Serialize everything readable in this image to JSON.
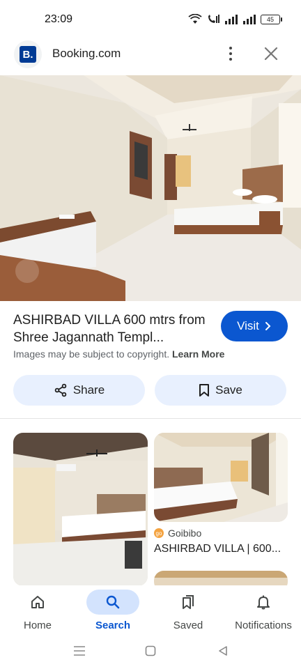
{
  "status": {
    "time": "23:09",
    "battery": "45"
  },
  "header": {
    "logo_letter": "B.",
    "site": "Booking.com"
  },
  "result": {
    "title": "ASHIRBAD VILLA 600 mtrs from Shree Jagannath Templ...",
    "visit_label": "Visit",
    "copyright_text": "Images may be subject to copyright.",
    "learn_more": "Learn More",
    "share_label": "Share",
    "save_label": "Save"
  },
  "related": {
    "card_b_source": "Goibibo",
    "card_b_title": "ASHIRBAD VILLA | 600..."
  },
  "nav": {
    "items": [
      {
        "label": "Home",
        "icon": "home-icon"
      },
      {
        "label": "Search",
        "icon": "search-icon"
      },
      {
        "label": "Saved",
        "icon": "saved-icon"
      },
      {
        "label": "Notifications",
        "icon": "bell-icon"
      }
    ],
    "active": "Search"
  },
  "colors": {
    "accent": "#0b57d0",
    "chip_bg": "#e8f0fe",
    "brand": "#003b95"
  }
}
